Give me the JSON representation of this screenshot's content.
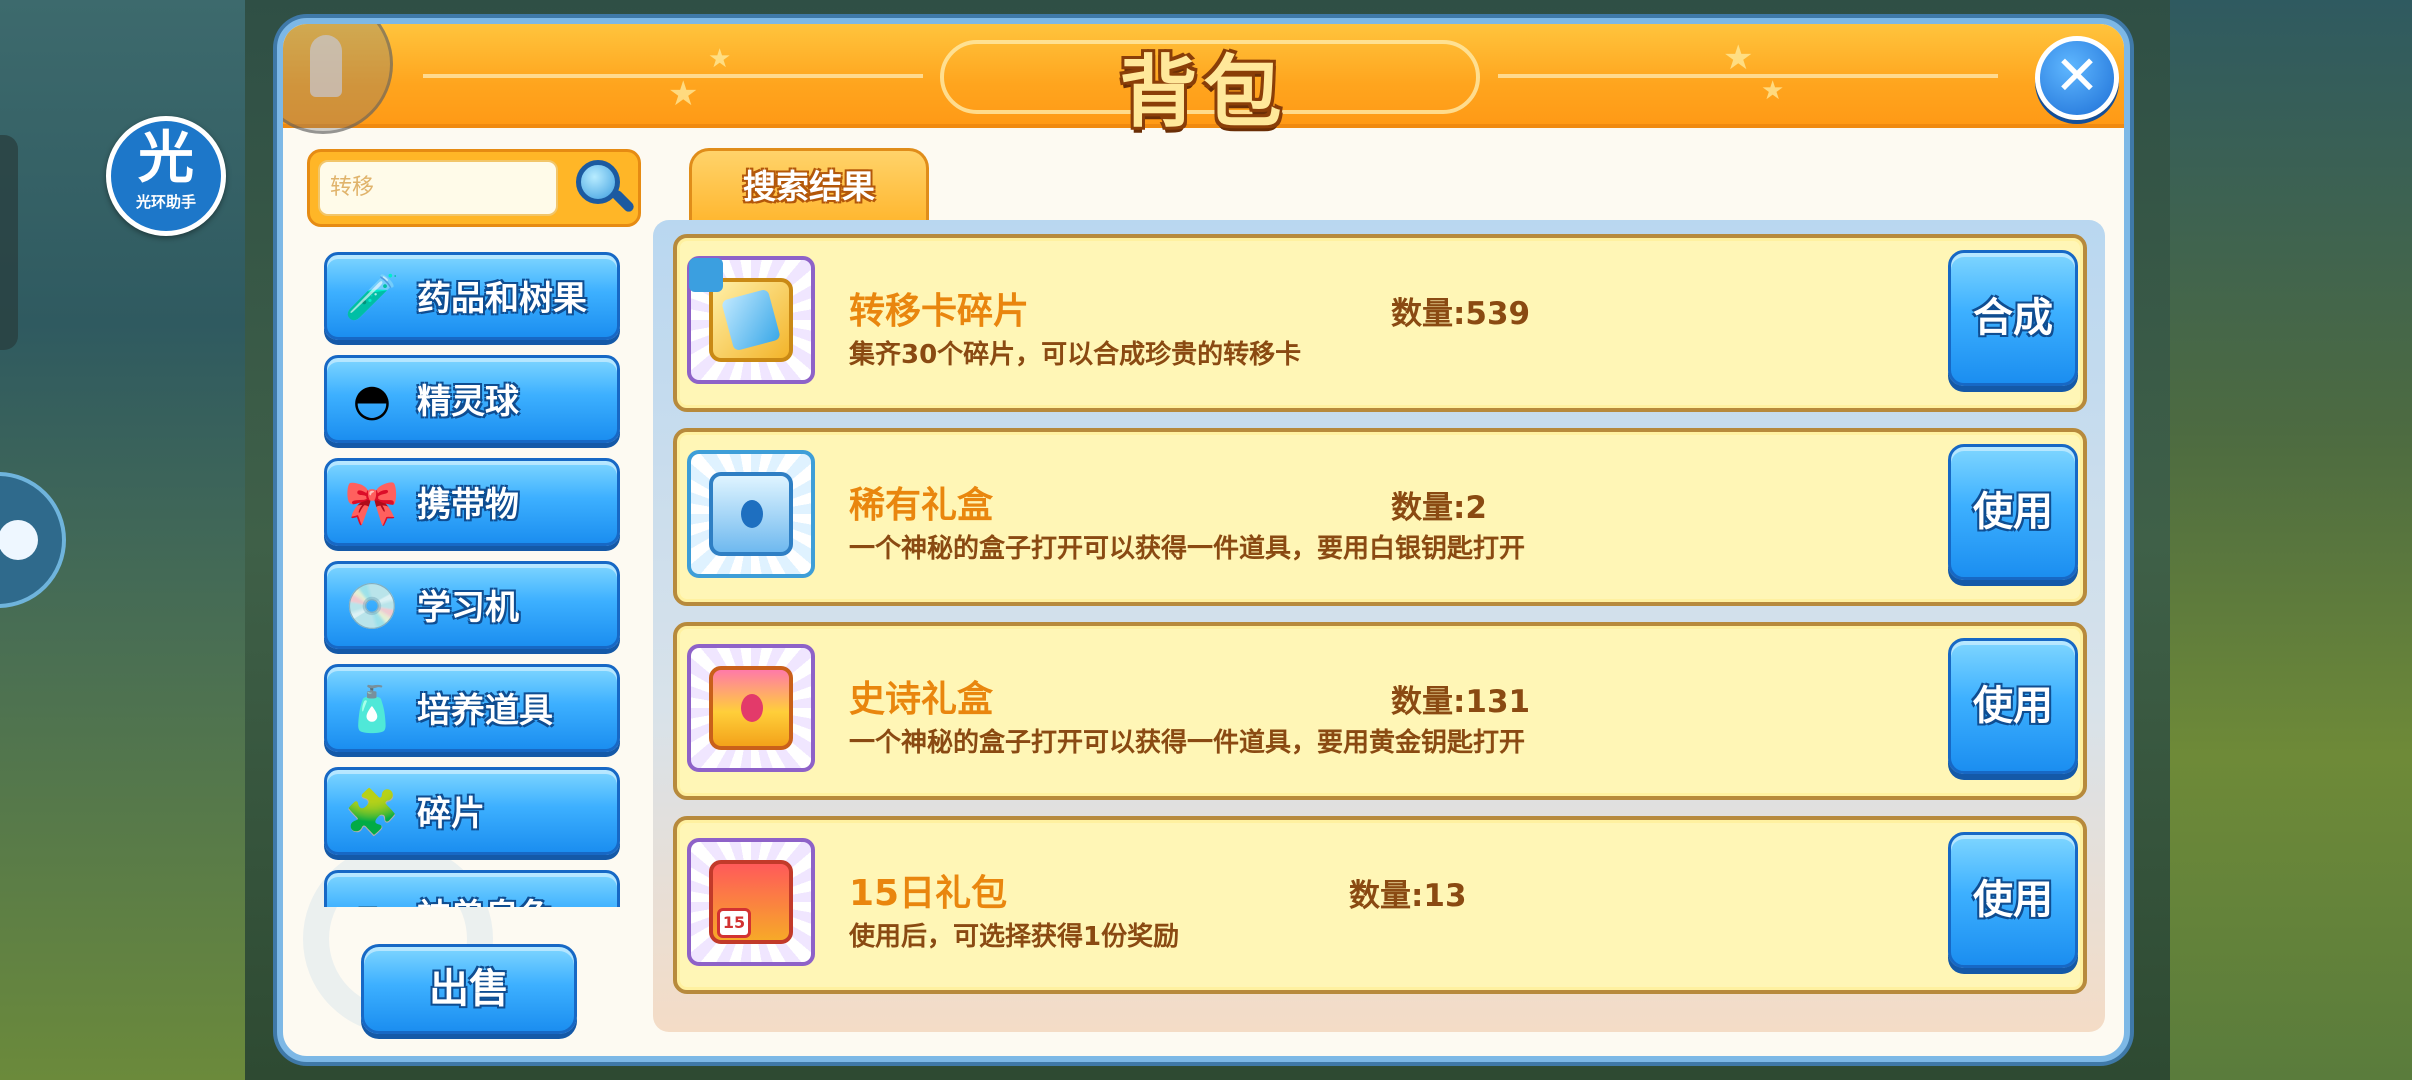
{
  "window": {
    "title": "背包",
    "close_label": "✕"
  },
  "halo_assistant": {
    "glyph": "光",
    "label": "光环助手"
  },
  "search": {
    "value": "",
    "placeholder": "转移"
  },
  "categories": [
    {
      "label": "药品和树果",
      "icon": "potion-icon",
      "glyph": "🧪"
    },
    {
      "label": "精灵球",
      "icon": "pokeball-icon",
      "glyph": "◓"
    },
    {
      "label": "携带物",
      "icon": "held-item-icon",
      "glyph": "🎀"
    },
    {
      "label": "学习机",
      "icon": "disc-icon",
      "glyph": "💿"
    },
    {
      "label": "培养道具",
      "icon": "training-item-icon",
      "glyph": "🧴"
    },
    {
      "label": "碎片",
      "icon": "puzzle-icon",
      "glyph": "🧩"
    },
    {
      "label": "神兽皇兔",
      "icon": "item-icon",
      "glyph": "✏"
    }
  ],
  "sell_button": "出售",
  "tab": {
    "label": "搜索结果"
  },
  "items": [
    {
      "name": "转移卡碎片",
      "quantity": "数量:539",
      "desc": "集齐30个碎片，可以合成珍贵的转移卡",
      "action": "合成",
      "icon": "transfer-card-shard-icon"
    },
    {
      "name": "稀有礼盒",
      "quantity": "数量:2",
      "desc": "一个神秘的盒子打开可以获得一件道具，要用白银钥匙打开",
      "action": "使用",
      "icon": "silver-chest-icon"
    },
    {
      "name": "史诗礼盒",
      "quantity": "数量:131",
      "desc": "一个神秘的盒子打开可以获得一件道具，要用黄金钥匙打开",
      "action": "使用",
      "icon": "gold-chest-icon"
    },
    {
      "name": "15日礼包",
      "quantity": "数量:13",
      "desc": "使用后，可选择获得1份奖励",
      "action": "使用",
      "icon": "gift-box-icon",
      "badge": "15"
    }
  ],
  "colors": {
    "accent": "#ffa51e",
    "button_blue": "#1b8ef0",
    "item_name": "#e9860e",
    "item_text": "#8a4a12"
  }
}
